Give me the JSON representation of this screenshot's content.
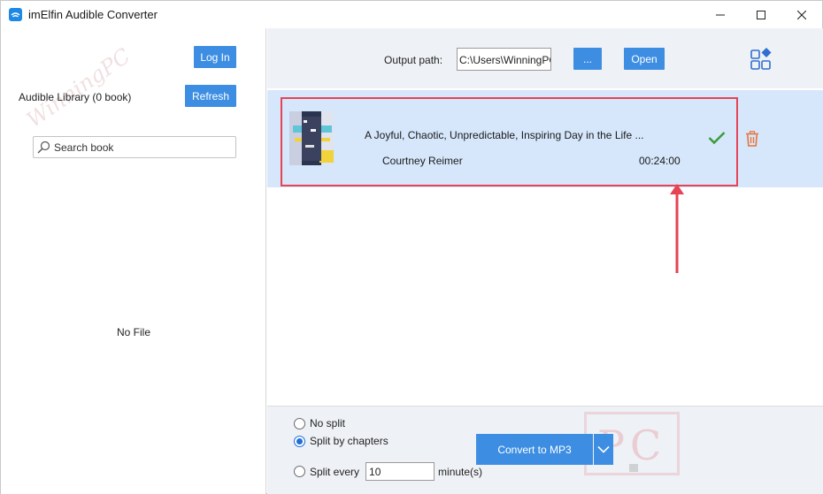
{
  "window": {
    "title": "imElfin Audible Converter",
    "icons": {
      "app": "audible-icon",
      "minimize": "minimize-icon",
      "maximize": "maximize-icon",
      "close": "close-icon"
    }
  },
  "sidebar": {
    "login_label": "Log In",
    "library_label": "Audible Library (0 book)",
    "refresh_label": "Refresh",
    "search_placeholder": "Search book",
    "empty_text": "No File",
    "watermark": "WinningPC"
  },
  "header": {
    "output_label": "Output path:",
    "output_path": "C:\\Users\\WinningPC\\i",
    "browse_label": "...",
    "open_label": "Open"
  },
  "list": {
    "items": [
      {
        "title": "A Joyful, Chaotic, Unpredictable, Inspiring Day in the Life ...",
        "author": "Courtney Reimer",
        "duration": "00:24:00",
        "status": "check-icon"
      }
    ]
  },
  "bottom": {
    "options": [
      "No split",
      "Split by chapters",
      "Split every"
    ],
    "selected_option": "Split by chapters",
    "split_value": "10",
    "split_unit": "minute(s)",
    "convert_label": "Convert to MP3",
    "watermark": "PC"
  },
  "colors": {
    "accent": "#3d8ee3",
    "selection": "#d6e7fb",
    "highlight": "#e64455",
    "check": "#3a9b3a",
    "trash": "#e8733a"
  }
}
